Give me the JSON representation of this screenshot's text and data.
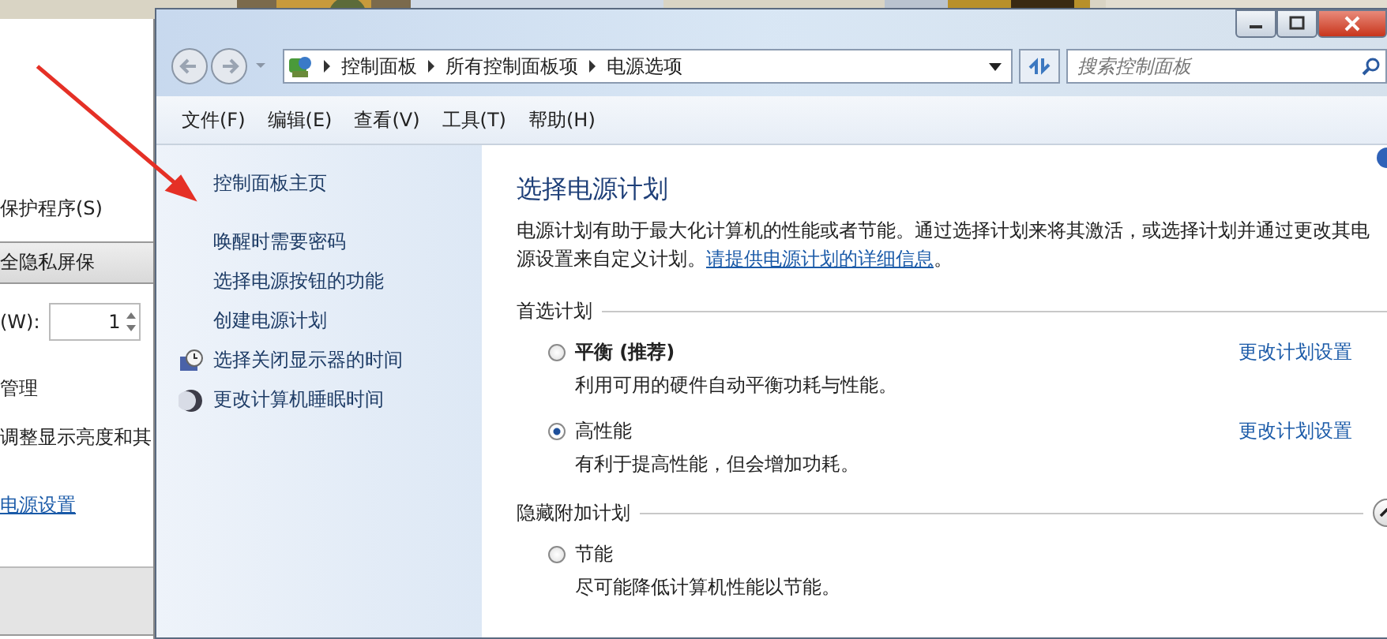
{
  "background_window": {
    "items": [
      {
        "kind": "label",
        "text": "保护程序(S)"
      },
      {
        "kind": "header",
        "text": "全隐私屏保"
      },
      {
        "kind": "spinner",
        "label": "(W):",
        "value": "1"
      },
      {
        "kind": "label",
        "text": "管理"
      },
      {
        "kind": "label",
        "text": "调整显示亮度和其"
      },
      {
        "kind": "link",
        "text": "电源设置"
      }
    ]
  },
  "window": {
    "breadcrumb": [
      "控制面板",
      "所有控制面板项",
      "电源选项"
    ],
    "search": {
      "placeholder": "搜索控制面板"
    },
    "menu": [
      "文件(F)",
      "编辑(E)",
      "查看(V)",
      "工具(T)",
      "帮助(H)"
    ],
    "sidebar": {
      "items": [
        {
          "text": "控制面板主页",
          "kind": "plain"
        },
        {
          "text": "唤醒时需要密码",
          "kind": "plain"
        },
        {
          "text": "选择电源按钮的功能",
          "kind": "plain"
        },
        {
          "text": "创建电源计划",
          "kind": "plain"
        },
        {
          "text": "选择关闭显示器的时间",
          "kind": "display"
        },
        {
          "text": "更改计算机睡眠时间",
          "kind": "sleep"
        }
      ]
    },
    "content": {
      "title": "选择电源计划",
      "description": "电源计划有助于最大化计算机的性能或者节能。通过选择计划来将其激活，或选择计划并通过更改其电源设置来自定义计划。",
      "link": "请提供电源计划的详细信息",
      "link_suffix": "。",
      "groups": [
        {
          "title": "首选计划",
          "collapsible": false,
          "plans": [
            {
              "name": "平衡 (推荐)",
              "bold": true,
              "selected": false,
              "description": "利用可用的硬件自动平衡功耗与性能。",
              "settings_link": "更改计划设置"
            },
            {
              "name": "高性能",
              "bold": false,
              "selected": true,
              "description": "有利于提高性能，但会增加功耗。",
              "settings_link": "更改计划设置"
            }
          ]
        },
        {
          "title": "隐藏附加计划",
          "collapsible": true,
          "plans": [
            {
              "name": "节能",
              "bold": false,
              "selected": false,
              "description": "尽可能降低计算机性能以节能。"
            }
          ]
        }
      ]
    }
  }
}
